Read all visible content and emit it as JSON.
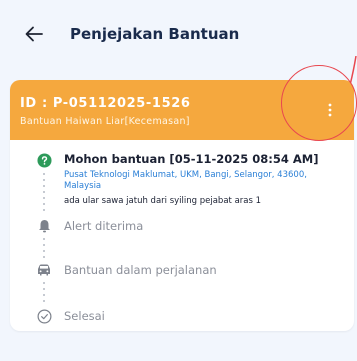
{
  "header": {
    "title": "Penjejakan Bantuan",
    "back_icon": "arrow-left-icon"
  },
  "card": {
    "id_text": "ID : P-05112025-1526",
    "category": "Bantuan Haiwan Liar[Kecemasan]",
    "menu_icon": "more-vertical-icon",
    "header_color": "#f5a83e"
  },
  "steps": [
    {
      "icon": "help-circle-icon",
      "label": "Mohon bantuan [05-11-2025 08:54 AM]",
      "location": "Pusat Teknologi Maklumat, UKM, Bangi, Selangor, 43600, Malaysia",
      "note": "ada ular sawa jatuh dari syiling pejabat aras 1",
      "active": true
    },
    {
      "icon": "bell-icon",
      "label": "Alert diterima",
      "active": false
    },
    {
      "icon": "car-icon",
      "label": "Bantuan dalam perjalanan",
      "active": false
    },
    {
      "icon": "check-circle-icon",
      "label": "Selesai",
      "active": false
    }
  ],
  "colors": {
    "active_step": "#2d9a5a",
    "link_text": "#2a7fd6",
    "highlight_circle": "#e8474f"
  }
}
